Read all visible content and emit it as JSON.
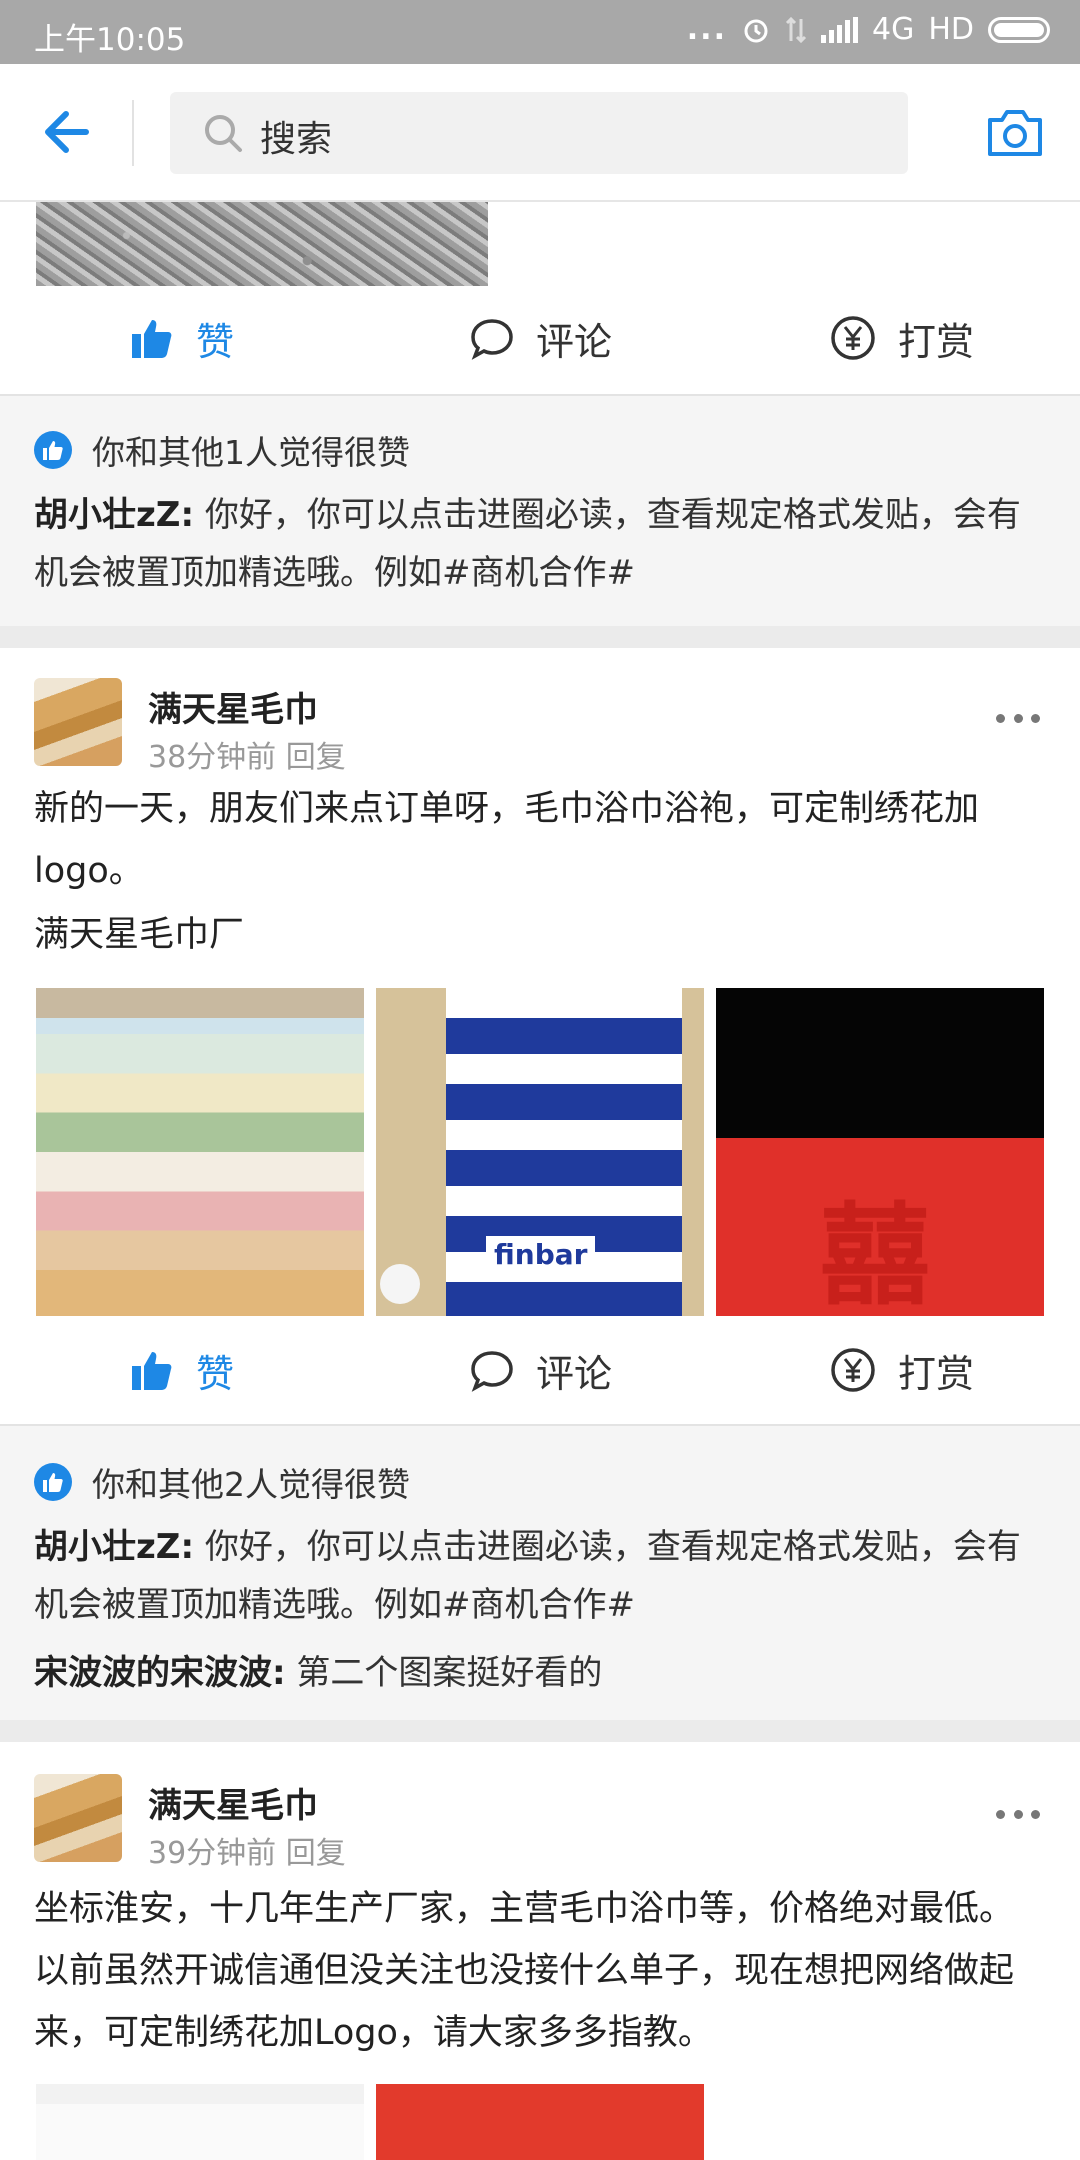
{
  "status_bar": {
    "time": "上午10:05",
    "dots": "...",
    "network": "4G",
    "hd": "HD"
  },
  "top_bar": {
    "search_placeholder": "搜索"
  },
  "actions": {
    "like": "赞",
    "comment": "评论",
    "tip": "打赏"
  },
  "post0": {
    "likes_text": "你和其他1人觉得很赞",
    "comments": [
      {
        "author": "胡小壮zZ:",
        "text": " 你好，你可以点击进圈必读，查看规定格式发贴，会有机会被置顶加精选哦。例如#商机合作#"
      }
    ]
  },
  "post1": {
    "name": "满天星毛巾",
    "meta": "38分钟前 回复",
    "text_line1": "新的一天，朋友们来点订单呀，毛巾浴巾浴袍，可定制绣花加logo。",
    "text_line2": "满天星毛巾厂",
    "images": [
      "towel-stack",
      "striped-towel",
      "red-towel"
    ],
    "thumb_logo": "finbar",
    "thumb_char": "囍",
    "likes_text": "你和其他2人觉得很赞",
    "comments": [
      {
        "author": "胡小壮zZ:",
        "text": " 你好，你可以点击进圈必读，查看规定格式发贴，会有机会被置顶加精选哦。例如#商机合作#"
      },
      {
        "author": "宋波波的宋波波:",
        "text": " 第二个图案挺好看的"
      }
    ]
  },
  "post2": {
    "name": "满天星毛巾",
    "meta": "39分钟前 回复",
    "text": "坐标淮安，十几年生产厂家，主营毛巾浴巾等，价格绝对最低。以前虽然开诚信通但没关注也没接什么单子，现在想把网络做起来，可定制绣花加Logo，请大家多多指教。"
  },
  "colors": {
    "accent": "#1e88e5",
    "status_bar_bg": "#a8a8a8",
    "separator": "#ebebeb"
  }
}
